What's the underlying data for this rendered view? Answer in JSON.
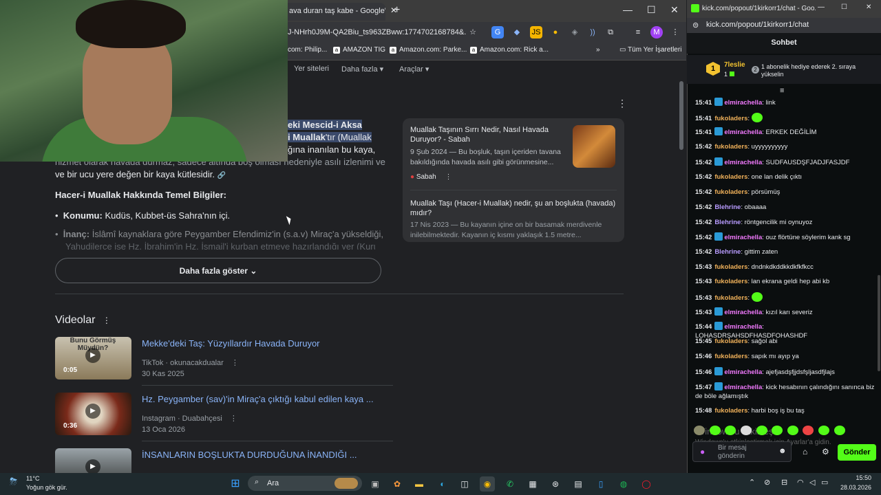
{
  "browser": {
    "tab_title": "ava duran taş kabe - Google'da",
    "url": "J-NHrh0J9M-QA2Biu_ts963ZBww:1774702168784&...",
    "profile_initial": "M",
    "bookmarks": [
      "com: Philip...",
      "AMAZON TIG",
      "Amazon.com: Parke...",
      "Amazon.com: Rick a..."
    ],
    "bookmarks_all": "Tüm Yer İşaretleri",
    "nav": [
      "Yer siteleri",
      "Daha fazla",
      "Araçlar"
    ]
  },
  "overview": {
    "hl1": "eki Mescid-i Aksa",
    "hl2": "i Muallak",
    "hl2_rest": "'tır (Muallak",
    "line3_tail": "ğına inanılan bu kaya,",
    "line4": "hizmet olarak havada durmaz, sadece altında boş olması nedeniyle asılı izlenimi veren",
    "line5": "ve bir ucu yere değen bir kaya kütlesidir.",
    "heading": "Hacer-i Muallak Hakkında Temel Bilgiler:",
    "b1_label": "Konumu:",
    "b1_text": "Kudüs, Kubbet-üs Sahra'nın içi.",
    "b2_label": "İnanç:",
    "b2_text": "İslâmî kaynaklara göre Peygamber Efendimiz'in (s.a.v) Miraç'a yükseldiği,",
    "b2_text2": "Yahudilerce ise Hz. İbrahim'in Hz. İsmail'i kurban etmeye hazırlandığı yer (Kurulus",
    "show_more": "Daha fazla göster"
  },
  "sources": [
    {
      "title": "Muallak Taşının Sırrı Nedir, Nasıl Havada Duruyor? - Sabah",
      "snippet": "9 Şub 2024 — Bu boşluk, taşın içeriden tavana bakıldığında havada asılı gibi görünmesine...",
      "site": "Sabah"
    },
    {
      "title": "Muallak Taşı (Hacer-i Muallak) nedir, şu an boşlukta (havada) mıdır?",
      "snippet": "17 Nis 2023 — Bu kayanın içine on bir basamak merdivenle inilebilmektedir. Kayanın iç kısmı yaklaşık 1.5 metre..."
    }
  ],
  "videos": {
    "heading": "Videolar",
    "items": [
      {
        "title": "Mekke'deki Taş: Yüzyıllardır Havada Duruyor",
        "source": "TikTok · okunacakdualar",
        "date": "30 Kas 2025",
        "duration": "0:05",
        "thumb_text": "Bunu Görmüş Müydün?"
      },
      {
        "title": "Hz. Peygamber (sav)'in Miraç'a çıktığı kabul edilen kaya ...",
        "source": "Instagram · Duabahçesi",
        "date": "13 Oca 2026",
        "duration": "0:36"
      },
      {
        "title": "İNSANLARIN BOŞLUKTA DURDUĞUNA İNANDIĞI ..."
      }
    ]
  },
  "chat": {
    "window_title": "kick.com/popout/1kirkorr1/chat - Goo...",
    "url": "kick.com/popout/1kirkorr1/chat",
    "header": "Sohbet",
    "top_user": "7leslie",
    "top_count": "1",
    "gift_rank": "2",
    "gift_text": "1 abonelik hediye ederek 2. sıraya yükselin",
    "messages": [
      {
        "time": "15:41",
        "user": "elmirachella",
        "color": "pink",
        "badge": true,
        "text": "link"
      },
      {
        "time": "15:41",
        "user": "fukoladers",
        "color": "orange",
        "emote": true,
        "text": ""
      },
      {
        "time": "15:41",
        "user": "elmirachella",
        "color": "pink",
        "badge": true,
        "text": "ERKEK DEĞİLİM"
      },
      {
        "time": "15:42",
        "user": "fukoladers",
        "color": "orange",
        "text": "uyyyyyyyyyy"
      },
      {
        "time": "15:42",
        "user": "elmirachella",
        "color": "pink",
        "badge": true,
        "text": "SUDFAUSDŞFJADJFASJDF"
      },
      {
        "time": "15:42",
        "user": "fukoladers",
        "color": "orange",
        "text": "one lan delik çıktı"
      },
      {
        "time": "15:42",
        "user": "fukoladers",
        "color": "orange",
        "text": "pörsümüş"
      },
      {
        "time": "15:42",
        "user": "Blehrine",
        "color": "purple",
        "text": "obaaaa"
      },
      {
        "time": "15:42",
        "user": "Blehrine",
        "color": "purple",
        "text": "röntgencilik mi oynuyoz"
      },
      {
        "time": "15:42",
        "user": "elmirachella",
        "color": "pink",
        "badge": true,
        "text": "ouz flörtüne söylerim kank sg"
      },
      {
        "time": "15:42",
        "user": "Blehrine",
        "color": "purple",
        "text": "gittim zaten"
      },
      {
        "time": "15:43",
        "user": "fukoladers",
        "color": "orange",
        "text": "dndnkdkddkkdkfkfkcc"
      },
      {
        "time": "15:43",
        "user": "fukoladers",
        "color": "orange",
        "text": "lan ekrana geldi hep abi kb"
      },
      {
        "time": "15:43",
        "user": "fukoladers",
        "color": "orange",
        "emote": true,
        "text": ""
      },
      {
        "time": "15:43",
        "user": "elmirachella",
        "color": "pink",
        "badge": true,
        "text": "kızıl karı severiz"
      },
      {
        "time": "15:44",
        "user": "elmirachella",
        "color": "pink",
        "badge": true,
        "text": "LOHASDRŞAHSDFHASDFOHASHDF"
      },
      {
        "time": "15:45",
        "user": "fukoladers",
        "color": "orange",
        "text": "sağol abi"
      },
      {
        "time": "15:46",
        "user": "fukoladers",
        "color": "orange",
        "text": "sapık mı ayıp ya"
      },
      {
        "time": "15:46",
        "user": "elmirachella",
        "color": "pink",
        "badge": true,
        "text": "ajefjasdşfjjdsfşljasdfjlajs"
      },
      {
        "time": "15:47",
        "user": "elmirachella",
        "color": "pink",
        "badge": true,
        "text": "kick hesabının çalındığını sanınca biz de böle ağlamıştık"
      },
      {
        "time": "15:48",
        "user": "fukoladers",
        "color": "orange",
        "text": "harbi boş iş bu taş"
      }
    ],
    "watermark": "Windows'u etkinleştirmek için Ayarlar'a gidin.",
    "watermark_title": "Windows'u Etkinleştir",
    "input_placeholder": "Bir mesaj gönderin",
    "send": "Gönder"
  },
  "taskbar": {
    "weather_temp": "11°C",
    "weather_desc": "Yoğun gök gür.",
    "search": "Ara",
    "time": "15:50",
    "date": "28.03.2026"
  }
}
